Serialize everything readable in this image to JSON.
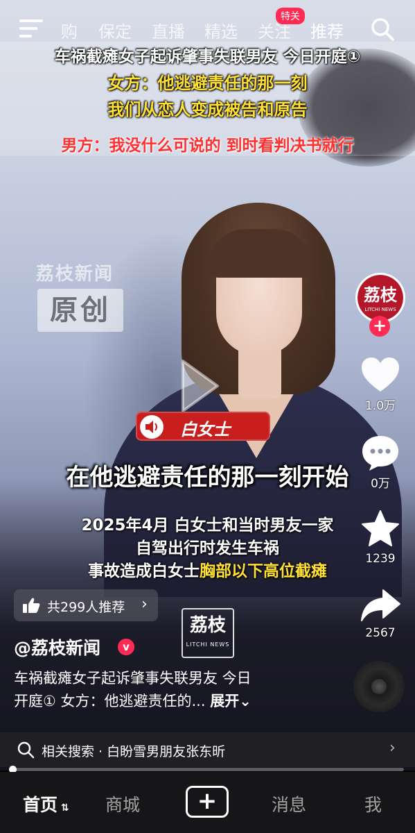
{
  "top_nav": {
    "tabs": [
      "购",
      "保定",
      "直播",
      "精选",
      "关注",
      "推荐"
    ],
    "active_tab": "推荐",
    "badge": "特关"
  },
  "overlay": {
    "headline": "车祸截瘫女子起诉肇事失联男友 今日开庭①",
    "female_line1": "女方：他逃避责任的那一刻",
    "female_line2": "我们从恋人变成被告和原告",
    "male_line": "男方：我没什么可说的 到时看判决书就行"
  },
  "watermark": {
    "name": "荔枝新闻",
    "label": "原创"
  },
  "speaker": {
    "name": "白女士"
  },
  "captions": {
    "main": "在他逃避责任的那一刻开始",
    "line1": "2025年4月 白女士和当时男友一家",
    "line2": "自驾出行时发生车祸",
    "line3_prefix": "事故造成白女士",
    "line3_highlight": "胸部以下高位截瘫"
  },
  "rail": {
    "avatar_text": "荔枝",
    "avatar_sub": "LITCHI NEWS",
    "likes": "1.0万",
    "comments": "0万",
    "favorites": "1239",
    "shares": "2567"
  },
  "recommend": {
    "text": "共299人推荐"
  },
  "center_logo": {
    "big": "荔枝",
    "small": "LITCHI NEWS"
  },
  "author": {
    "name": "@荔枝新闻",
    "verified_mark": "v"
  },
  "description": {
    "line1": "车祸截瘫女子起诉肇事失联男友 今日",
    "line2": "开庭① 女方：他逃避责任的...",
    "expand": "展开"
  },
  "related_search": {
    "text": "相关搜索 · 白盼雪男朋友张东昕"
  },
  "progress": {
    "fraction": 0.0
  },
  "bottom_nav": {
    "home": "首页",
    "mall": "商城",
    "plus": "+",
    "messages": "消息",
    "me": "我"
  }
}
